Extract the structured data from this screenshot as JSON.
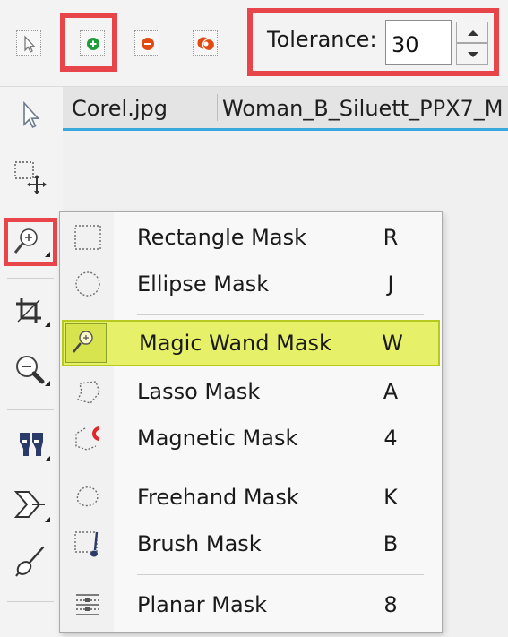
{
  "property_bar": {
    "mode_buttons": [
      {
        "icon": "arrow-select-icon",
        "name": "normal-mode-button"
      },
      {
        "icon": "add-plus-icon",
        "name": "additive-mode-button",
        "color": "#1e9e3a"
      },
      {
        "icon": "subtract-minus-icon",
        "name": "subtractive-mode-button",
        "color": "#e34a12"
      },
      {
        "icon": "xor-mode-icon",
        "name": "xor-mode-button",
        "color": "#e34a12"
      }
    ],
    "tolerance_label": "Tolerance:",
    "tolerance_value": "30",
    "highlight_color": "#e8454a"
  },
  "toolbox": {
    "tools": [
      {
        "icon": "pick-arrow-icon"
      },
      {
        "icon": "transform-selection-icon"
      },
      {
        "icon": "magic-wand-tool-icon",
        "selected": true
      },
      {
        "icon": "crop-tool-icon"
      },
      {
        "icon": "zoom-tool-icon"
      },
      {
        "icon": "eyedropper-tool-icon"
      },
      {
        "icon": "shape-tool-icon"
      },
      {
        "icon": "paint-brush-tool-icon"
      }
    ]
  },
  "document_tabs": {
    "tabs": [
      "Corel.jpg",
      "Woman_B_Siluett_PPX7_M"
    ],
    "active_underline_color": "#39a9dd"
  },
  "mask_menu": {
    "items": [
      {
        "label": "Rectangle Mask",
        "key": "R",
        "icon": "rectangle-mask-icon"
      },
      {
        "label": "Ellipse Mask",
        "key": "J",
        "icon": "ellipse-mask-icon"
      },
      {
        "label": "Magic Wand Mask",
        "key": "W",
        "icon": "magic-wand-mask-icon",
        "active": true
      },
      {
        "label": "Lasso Mask",
        "key": "A",
        "icon": "lasso-mask-icon"
      },
      {
        "label": "Magnetic Mask",
        "key": "4",
        "icon": "magnetic-mask-icon"
      },
      {
        "label": "Freehand Mask",
        "key": "K",
        "icon": "freehand-mask-icon"
      },
      {
        "label": "Brush Mask",
        "key": "B",
        "icon": "brush-mask-icon"
      },
      {
        "label": "Planar Mask",
        "key": "8",
        "icon": "planar-mask-icon"
      }
    ],
    "active_color": "#e6f068"
  }
}
